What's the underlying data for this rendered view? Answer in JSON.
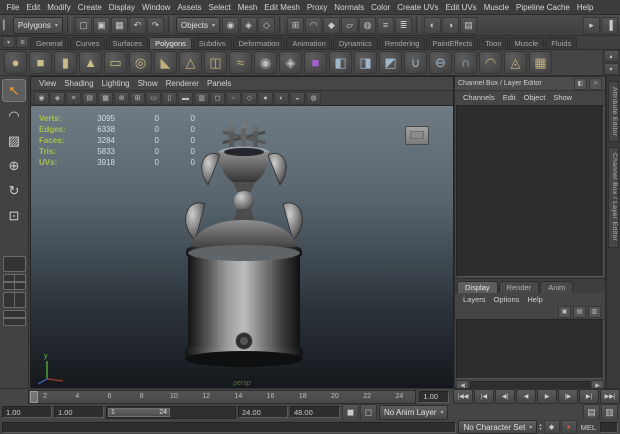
{
  "colors": {
    "hud_label": "#a9c24b",
    "hud_value": "#d7dde2",
    "viewport_top": "#6e7b84",
    "viewport_bottom": "#14181c",
    "autokey_red": "#d2543e",
    "active_tool_accent": "#f0a030"
  },
  "glyphs": {
    "chevron_down": "▾",
    "chevron_up": "▴",
    "scroll_left": "◀",
    "scroll_right": "▶",
    "collapse_handle": "▎"
  },
  "menubar": {
    "items": [
      "File",
      "Edit",
      "Modify",
      "Create",
      "Display",
      "Window",
      "Assets",
      "Select",
      "Mesh",
      "Edit Mesh",
      "Proxy",
      "Normals",
      "Color",
      "Create UVs",
      "Edit UVs",
      "Muscle",
      "Pipeline Cache",
      "Help"
    ]
  },
  "statusline": {
    "mode_selector": "Polygons",
    "objects_selector": "Objects",
    "file_icons": [
      {
        "name": "new-scene-icon",
        "glyph": "▢"
      },
      {
        "name": "open-scene-icon",
        "glyph": "▣"
      },
      {
        "name": "save-scene-icon",
        "glyph": "▦"
      },
      {
        "name": "undo-icon",
        "glyph": "↶"
      },
      {
        "name": "redo-icon",
        "glyph": "↷"
      }
    ],
    "selection_icons": [
      {
        "name": "select-hierarchy-icon",
        "glyph": "◉"
      },
      {
        "name": "select-object-icon",
        "glyph": "◈"
      },
      {
        "name": "select-component-icon",
        "glyph": "◇"
      }
    ],
    "snap_icons": [
      {
        "name": "snap-grid-icon",
        "glyph": "⊞"
      },
      {
        "name": "snap-curve-icon",
        "glyph": "◠"
      },
      {
        "name": "snap-point-icon",
        "glyph": "◆"
      },
      {
        "name": "snap-plane-icon",
        "glyph": "▱"
      },
      {
        "name": "make-live-icon",
        "glyph": "◍"
      },
      {
        "name": "input-connections-icon",
        "glyph": "≡"
      },
      {
        "name": "construction-history-icon",
        "glyph": "≣"
      }
    ],
    "render_icons": [
      {
        "name": "render-current-frame-icon",
        "glyph": "◐"
      },
      {
        "name": "ipr-render-icon",
        "glyph": "◑"
      },
      {
        "name": "render-settings-icon",
        "glyph": "▤"
      }
    ],
    "right_icons": [
      {
        "name": "input-line-toggle-icon",
        "glyph": "▸"
      },
      {
        "name": "sidebar-toggle-icon",
        "glyph": "▐"
      }
    ]
  },
  "shelf": {
    "tab_icons": [
      {
        "name": "shelf-switch-icon",
        "glyph": "▾"
      },
      {
        "name": "shelf-edit-icon",
        "glyph": "≣"
      }
    ],
    "tabs": [
      {
        "label": "General"
      },
      {
        "label": "Curves"
      },
      {
        "label": "Surfaces"
      },
      {
        "label": "Polygons",
        "active": true
      },
      {
        "label": "Subdivs"
      },
      {
        "label": "Deformation"
      },
      {
        "label": "Animation"
      },
      {
        "label": "Dynamics"
      },
      {
        "label": "Rendering"
      },
      {
        "label": "PaintEffects"
      },
      {
        "label": "Toon"
      },
      {
        "label": "Muscle"
      },
      {
        "label": "Fluids"
      }
    ],
    "icons": [
      {
        "name": "poly-sphere-icon",
        "glyph": "●",
        "color": "#cbbd86"
      },
      {
        "name": "poly-cube-icon",
        "glyph": "■",
        "color": "#cbbd86"
      },
      {
        "name": "poly-cylinder-icon",
        "glyph": "▮",
        "color": "#cbbd86"
      },
      {
        "name": "poly-cone-icon",
        "glyph": "▲",
        "color": "#cbbd86"
      },
      {
        "name": "poly-plane-icon",
        "glyph": "▭",
        "color": "#cbbd86"
      },
      {
        "name": "poly-torus-icon",
        "glyph": "◎",
        "color": "#cbbd86"
      },
      {
        "name": "poly-prism-icon",
        "glyph": "◣",
        "color": "#c2b27c"
      },
      {
        "name": "poly-pyramid-icon",
        "glyph": "△",
        "color": "#c2b27c"
      },
      {
        "name": "poly-pipe-icon",
        "glyph": "◫",
        "color": "#c2b27c"
      },
      {
        "name": "poly-helix-icon",
        "glyph": "≈",
        "color": "#c2b27c"
      },
      {
        "name": "poly-soccerball-icon",
        "glyph": "◉",
        "color": "#bcbcbc"
      },
      {
        "name": "poly-platonic-icon",
        "glyph": "◈",
        "color": "#bcbcbc"
      },
      {
        "name": "sculpt-object-icon",
        "glyph": "■",
        "color": "#a55fd6"
      },
      {
        "name": "combine-icon",
        "glyph": "◧",
        "color": "#9fb7c9"
      },
      {
        "name": "separate-icon",
        "glyph": "◨",
        "color": "#9fb7c9"
      },
      {
        "name": "extract-icon",
        "glyph": "◩",
        "color": "#9fb7c9"
      },
      {
        "name": "boolean-union-icon",
        "glyph": "∪",
        "color": "#9fb7c9"
      },
      {
        "name": "boolean-difference-icon",
        "glyph": "⊖",
        "color": "#9fb7c9"
      },
      {
        "name": "boolean-intersection-icon",
        "glyph": "∩",
        "color": "#9fb7c9"
      },
      {
        "name": "smooth-icon",
        "glyph": "◠",
        "color": "#c2b27c"
      },
      {
        "name": "triangulate-icon",
        "glyph": "◬",
        "color": "#c2b27c"
      },
      {
        "name": "quadrangulate-icon",
        "glyph": "▦",
        "color": "#c2b27c"
      }
    ],
    "side_icons": [
      {
        "name": "shelf-scroll-up-icon",
        "glyph": "▴"
      },
      {
        "name": "shelf-scroll-down-icon",
        "glyph": "▾"
      }
    ]
  },
  "toolbox": {
    "tools": [
      {
        "name": "select-tool",
        "glyph": "↖",
        "active": true
      },
      {
        "name": "lasso-tool",
        "glyph": "◠"
      },
      {
        "name": "paint-select-tool",
        "glyph": "▨"
      },
      {
        "name": "move-tool",
        "glyph": "⊕"
      },
      {
        "name": "rotate-tool",
        "glyph": "↻"
      },
      {
        "name": "scale-tool",
        "glyph": "⊡"
      }
    ]
  },
  "panel": {
    "menus": [
      "View",
      "Shading",
      "Lighting",
      "Show",
      "Renderer",
      "Panels"
    ],
    "toolbar_icons": [
      {
        "name": "select-camera-icon",
        "glyph": "◉"
      },
      {
        "name": "lock-camera-icon",
        "glyph": "◈"
      },
      {
        "name": "camera-attributes-icon",
        "glyph": "≡"
      },
      {
        "name": "bookmarks-icon",
        "glyph": "▤"
      },
      {
        "name": "image-plane-icon",
        "glyph": "▦"
      },
      {
        "name": "two-d-pan-zoom-icon",
        "glyph": "⊕"
      },
      {
        "name": "grid-toggle-icon",
        "glyph": "⊞"
      },
      {
        "name": "film-gate-icon",
        "glyph": "▭"
      },
      {
        "name": "resolution-gate-icon",
        "glyph": "▯"
      },
      {
        "name": "gate-mask-icon",
        "glyph": "▬"
      },
      {
        "name": "field-chart-icon",
        "glyph": "▥"
      },
      {
        "name": "safe-action-icon",
        "glyph": "◻"
      },
      {
        "name": "safe-title-icon",
        "glyph": "▫"
      },
      {
        "name": "wireframe-mode-icon",
        "glyph": "◇"
      },
      {
        "name": "shaded-mode-icon",
        "glyph": "●"
      },
      {
        "name": "textured-mode-icon",
        "glyph": "◐"
      },
      {
        "name": "lighting-icon",
        "glyph": "◒"
      },
      {
        "name": "xray-icon",
        "glyph": "◍"
      }
    ],
    "camera_label": "persp",
    "axis_label": "y"
  },
  "hud": {
    "rows": [
      {
        "label": "Verts:",
        "value": "3095",
        "sel": "0",
        "sel2": "0"
      },
      {
        "label": "Edges:",
        "value": "6338",
        "sel": "0",
        "sel2": "0"
      },
      {
        "label": "Faces:",
        "value": "3284",
        "sel": "0",
        "sel2": "0"
      },
      {
        "label": "Tris:",
        "value": "5833",
        "sel": "0",
        "sel2": "0"
      },
      {
        "label": "UVs:",
        "value": "3918",
        "sel": "0",
        "sel2": "0"
      }
    ]
  },
  "channel_box": {
    "title": "Channel Box / Layer Editor",
    "title_icons": [
      {
        "name": "dock-icon",
        "glyph": "◧"
      },
      {
        "name": "close-icon",
        "glyph": "×"
      }
    ],
    "menus": [
      "Channels",
      "Edit",
      "Object",
      "Show"
    ]
  },
  "layer_editor": {
    "tabs": [
      {
        "label": "Display",
        "active": true
      },
      {
        "label": "Render"
      },
      {
        "label": "Anim"
      }
    ],
    "menus": [
      "Layers",
      "Options",
      "Help"
    ],
    "icons": [
      {
        "name": "new-empty-layer-icon",
        "glyph": "▣"
      },
      {
        "name": "new-layer-from-selected-icon",
        "glyph": "▤"
      },
      {
        "name": "layer-options-icon",
        "glyph": "▥"
      }
    ]
  },
  "sidebar_tabs": [
    {
      "name": "tab-attribute-editor",
      "label": "Attribute Editor"
    },
    {
      "name": "tab-channel-box",
      "label": "Channel Box / Layer Editor"
    }
  ],
  "timeline": {
    "ticks": [
      "2",
      "4",
      "6",
      "8",
      "10",
      "12",
      "14",
      "16",
      "18",
      "20",
      "22",
      "24"
    ]
  },
  "timecontrols": {
    "current_time": "1.00",
    "transport": [
      {
        "name": "go-to-start-button",
        "glyph": "|◀◀"
      },
      {
        "name": "step-back-key-button",
        "glyph": "|◀"
      },
      {
        "name": "step-back-frame-button",
        "glyph": "◀|"
      },
      {
        "name": "play-backward-button",
        "glyph": "◀"
      },
      {
        "name": "play-forward-button",
        "glyph": "▶"
      },
      {
        "name": "step-forward-frame-button",
        "glyph": "|▶"
      },
      {
        "name": "step-forward-key-button",
        "glyph": "▶|"
      },
      {
        "name": "go-to-end-button",
        "glyph": "▶▶|"
      }
    ]
  },
  "rangebar": {
    "playback_start": "1.00",
    "anim_start": "1.00",
    "handle_start": "1",
    "handle_end": "24",
    "playback_end": "24.00",
    "anim_end": "48.00",
    "mid_icons": [
      {
        "name": "anim-layer-mute-icon",
        "glyph": "◼"
      },
      {
        "name": "anim-layer-solo-icon",
        "glyph": "◻"
      }
    ],
    "anim_layer": "No Anim Layer",
    "end_icons": [
      {
        "name": "playback-options-icon",
        "glyph": "▤"
      },
      {
        "name": "anim-preferences-icon",
        "glyph": "▥"
      }
    ]
  },
  "commandline": {
    "character_set": "No Character Set",
    "key_icons": [
      {
        "name": "set-key-icon",
        "glyph": "◆"
      },
      {
        "name": "auto-keyframe-icon",
        "glyph": "●",
        "color": "#d2543e"
      }
    ],
    "mel_label": "MEL"
  }
}
